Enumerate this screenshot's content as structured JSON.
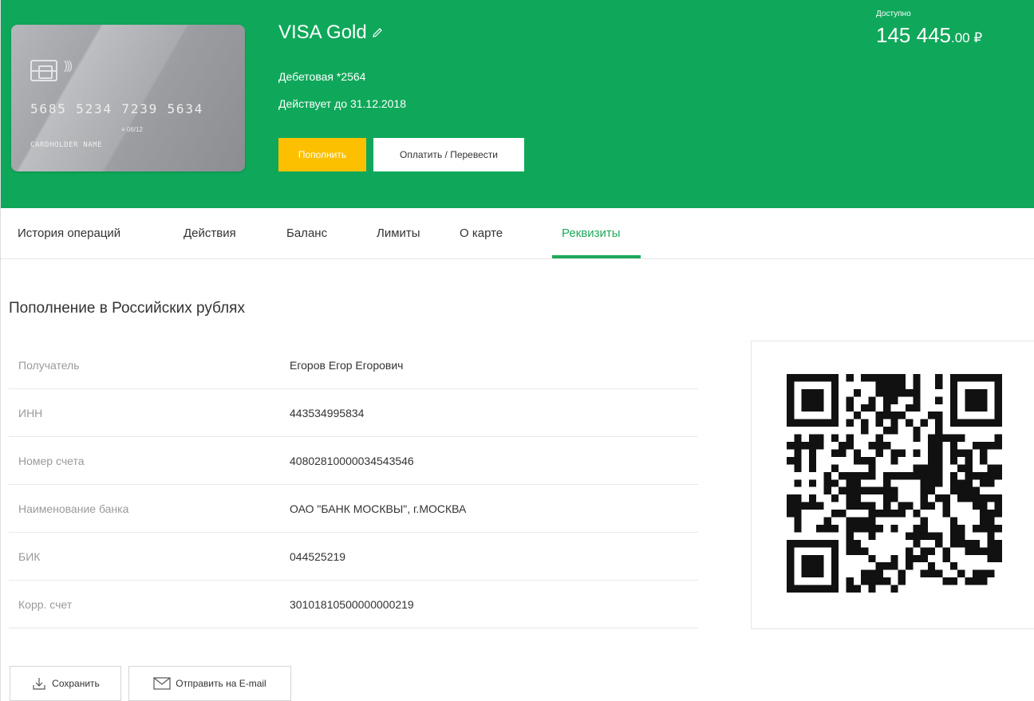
{
  "card": {
    "number": "5685 5234 7239 5634",
    "expiry": "06/12",
    "holder": "CARDHOLDER NAME"
  },
  "header": {
    "title": "VISA Gold",
    "type": "Дебетовая *2564",
    "valid_until": "Действует до 31.12.2018",
    "topup_label": "Пополнить",
    "pay_label": "Оплатить / Перевести",
    "available_label": "Доступно",
    "available_int": "145 445",
    "available_dec": ".00 ₽",
    "bg_color": "#0fa85a",
    "topup_color": "#fcc000"
  },
  "tabs": [
    {
      "label": "История операций"
    },
    {
      "label": "Действия"
    },
    {
      "label": "Баланс"
    },
    {
      "label": "Лимиты"
    },
    {
      "label": "О карте"
    },
    {
      "label": "Реквизиты",
      "active": true
    }
  ],
  "section": {
    "title": "Пополнение в Российских рублях"
  },
  "details": [
    {
      "label": "Получатель",
      "value": "Егоров Егор Егорович"
    },
    {
      "label": "ИНН",
      "value": "443534995834"
    },
    {
      "label": "Номер счета",
      "value": "40802810000034543546"
    },
    {
      "label": "Наименование банка",
      "value": "ОАО \"БАНК МОСКВЫ\", г.МОСКВА"
    },
    {
      "label": "БИК",
      "value": "044525219"
    },
    {
      "label": "Корр. счет",
      "value": "30101810500000000219"
    }
  ],
  "actions": {
    "save_label": "Сохранить",
    "email_label": "Отправить на E-mail"
  },
  "accent_color": "#1fa85a"
}
